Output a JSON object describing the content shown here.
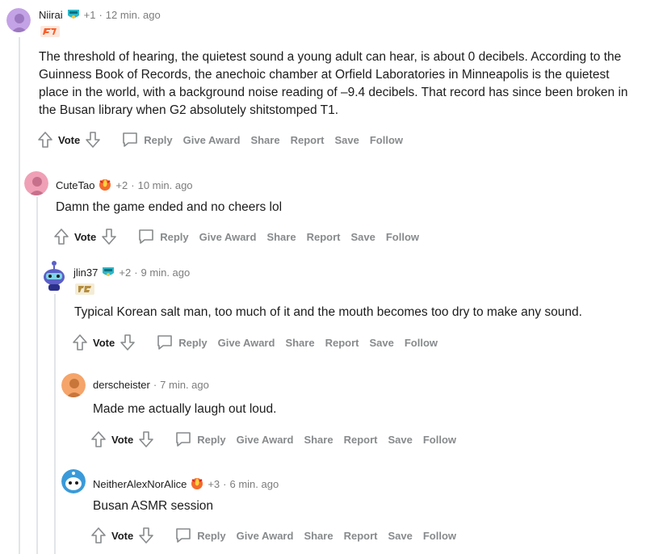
{
  "actions": {
    "vote": "Vote",
    "reply": "Reply",
    "give_award": "Give Award",
    "share": "Share",
    "report": "Report",
    "save": "Save",
    "follow": "Follow"
  },
  "comments": [
    {
      "author": "Niirai",
      "karma": "+1",
      "time": "12 min. ago",
      "flair_icon": "fnatic-flair-icon",
      "award_icon": "helmet-award-icon",
      "avatar_color": "#c4a2e6",
      "body": "The threshold of hearing, the quietest sound a young adult can hear, is about 0 decibels. According to the Guinness Book of Records, the anechoic chamber at Orfield Laboratories in Minneapolis is the quietest place in the world, with a background noise reading of –9.4 decibels. That record has since been broken in the Busan library when G2 absolutely shitstomped T1."
    },
    {
      "author": "CuteTao",
      "karma": "+2",
      "time": "10 min. ago",
      "award_icon": "fire-award-icon",
      "avatar_color": "#f0a0b6",
      "body": "Damn the game ended and no cheers lol"
    },
    {
      "author": "jlin37",
      "karma": "+2",
      "time": "9 min. ago",
      "flair_icon": "rng-flair-icon",
      "award_icon": "helmet-award-icon",
      "avatar_color": "#5b5fc7",
      "body": "Typical Korean salt man, too much of it and the mouth becomes too dry to make any sound."
    },
    {
      "author": "derscheister",
      "time": "7 min. ago",
      "avatar_color": "#f5a46a",
      "body": "Made me actually laugh out loud."
    },
    {
      "author": "NeitherAlexNorAlice",
      "karma": "+3",
      "time": "6 min. ago",
      "award_icon": "fire-award-icon",
      "avatar_color": "#3a9ad9",
      "body": "Busan ASMR session"
    }
  ]
}
